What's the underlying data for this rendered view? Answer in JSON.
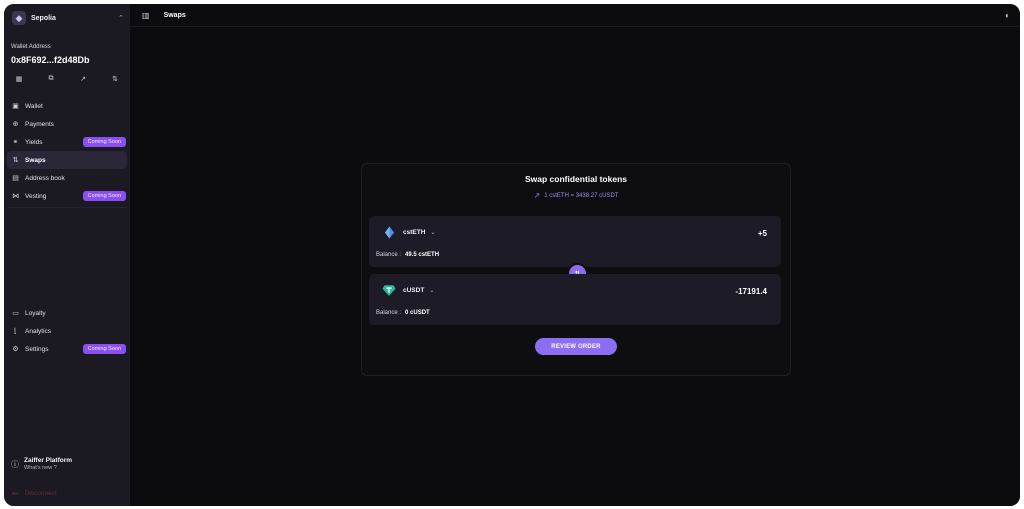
{
  "network": {
    "name": "Sepolia",
    "icon": "ethereum-icon"
  },
  "wallet": {
    "label": "Wallet Address",
    "address": "0x8F692...f2d48Db",
    "actions": [
      {
        "name": "qr-code-icon",
        "glyph": "▦"
      },
      {
        "name": "copy-icon",
        "glyph": "⧉"
      },
      {
        "name": "external-link-icon",
        "glyph": "↗"
      },
      {
        "name": "transfer-icon",
        "glyph": "⇅"
      }
    ]
  },
  "nav": {
    "items": [
      {
        "label": "Wallet",
        "icon": "wallet-icon",
        "glyph": "▣"
      },
      {
        "label": "Payments",
        "icon": "payments-icon",
        "glyph": "⊕"
      },
      {
        "label": "Yields",
        "icon": "yields-icon",
        "glyph": "⚭",
        "badge": "Coming Soon"
      },
      {
        "label": "Swaps",
        "icon": "swap-icon",
        "glyph": "⇅",
        "active": true
      },
      {
        "label": "Address book",
        "icon": "address-book-icon",
        "glyph": "▤"
      },
      {
        "label": "Vesting",
        "icon": "vesting-icon",
        "glyph": "⋈",
        "badge": "Coming Soon"
      }
    ],
    "secondary": [
      {
        "label": "Loyalty",
        "icon": "loyalty-icon",
        "glyph": "▭"
      },
      {
        "label": "Analytics",
        "icon": "analytics-icon",
        "glyph": "⌊"
      },
      {
        "label": "Settings",
        "icon": "settings-icon",
        "glyph": "⚙",
        "badge": "Coming Soon"
      }
    ]
  },
  "platform": {
    "title": "Zaiffer Platform",
    "subtitle": "What's new ?"
  },
  "disconnect_label": "Disconnect",
  "topbar": {
    "title": "Swaps"
  },
  "swap": {
    "title": "Swap confidential tokens",
    "rate": "1 cstETH = 3438.27 cUSDT",
    "from": {
      "token": "cstETH",
      "amount": "+5",
      "balance_label": "Balance :",
      "balance": "49.5 cstETH"
    },
    "to": {
      "token": "cUSDT",
      "amount": "-17191.4",
      "balance_label": "Balance :",
      "balance": "0 cUSDT"
    },
    "review_label": "REVIEW ORDER"
  },
  "colors": {
    "accent": "#8b6ef0",
    "badge": "#8a4ff0",
    "sidebar": "#1b1a23",
    "background": "#0c0c0e"
  }
}
